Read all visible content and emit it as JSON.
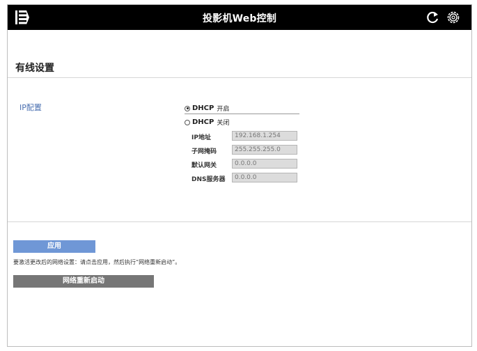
{
  "header": {
    "title": "投影机Web控制",
    "icons": [
      "menu-icon",
      "refresh-icon",
      "gear-icon"
    ]
  },
  "section": {
    "title": "有线设置"
  },
  "ip_config": {
    "label": "IP配置",
    "dhcp_on": {
      "label": "DHCP",
      "state": "开启",
      "selected": true
    },
    "dhcp_off": {
      "label": "DHCP",
      "state": "关闭",
      "selected": false
    },
    "fields": [
      {
        "label": "IP地址",
        "value": "192.168.1.254"
      },
      {
        "label": "子网掩码",
        "value": "255.255.255.0"
      },
      {
        "label": "默认网关",
        "value": "0.0.0.0"
      },
      {
        "label": "DNS服务器",
        "value": "0.0.0.0"
      }
    ]
  },
  "actions": {
    "apply_label": "应用",
    "hint": "要激活更改后的网络设置：请点击应用，然后执行“网络重新启动”。",
    "restart_label": "网络重新启动"
  },
  "colors": {
    "header_bg": "#000000",
    "accent_blue": "#6f97d6",
    "label_blue": "#4a6fb0",
    "restart_gray": "#767676"
  }
}
